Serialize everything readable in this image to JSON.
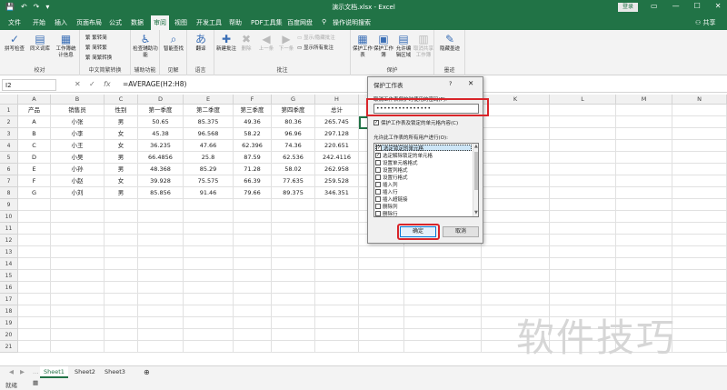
{
  "titlebar": {
    "qat": [
      "💾",
      "↶",
      "↷",
      "▾"
    ],
    "doc_title": "演示文档.xlsx - Excel",
    "login": "登录",
    "win_buttons": [
      "▭",
      "—",
      "☐",
      "✕"
    ]
  },
  "tabs": [
    "文件",
    "开始",
    "插入",
    "页面布局",
    "公式",
    "数据",
    "审阅",
    "视图",
    "开发工具",
    "帮助",
    "PDF工具集",
    "百度网盘",
    "操作说明搜索"
  ],
  "active_tab": "审阅",
  "share": "共享",
  "ribbon": {
    "proofing": {
      "label": "校对",
      "spell": "拼写检查",
      "thesaurus": "同义词库",
      "stats": "工作簿统计信息"
    },
    "chinese": {
      "label": "中文简繁转换",
      "t2s": "繁转简",
      "s2t": "简转繁",
      "convert": "简繁转换"
    },
    "accessibility": {
      "label": "辅助功能",
      "check": "检查辅助功能"
    },
    "insights": {
      "label": "见解",
      "smart": "智能查找"
    },
    "language": {
      "label": "语言",
      "translate": "翻译"
    },
    "comments": {
      "label": "批注",
      "new": "新建批注",
      "delete": "删除",
      "prev": "上一条",
      "next": "下一条",
      "show_hide": "显示/隐藏批注",
      "show_all": "显示所有批注"
    },
    "protect": {
      "label": "保护",
      "sheet": "保护工作表",
      "workbook": "保护工作簿",
      "allow": "允许编辑区域",
      "unshare": "取消共享工作簿"
    },
    "ink": {
      "label": "墨迹",
      "hide": "隐藏墨迹"
    }
  },
  "formula_bar": {
    "name_box": "I2",
    "cancel": "✕",
    "enter": "✓",
    "fx": "fx",
    "formula": "=AVERAGE(H2:H8)"
  },
  "columns": [
    "A",
    "B",
    "C",
    "D",
    "E",
    "F",
    "G",
    "H",
    "I",
    "J",
    "K",
    "L",
    "M",
    "N"
  ],
  "rows": [
    "1",
    "2",
    "3",
    "4",
    "5",
    "6",
    "7",
    "8",
    "9",
    "10",
    "11",
    "12",
    "13",
    "14",
    "15",
    "16",
    "17",
    "18",
    "19",
    "20",
    "21"
  ],
  "table": {
    "headers": [
      "产品",
      "销售员",
      "性别",
      "第一季度",
      "第二季度",
      "第三季度",
      "第四季度",
      "总计"
    ],
    "rows": [
      [
        "A",
        "小张",
        "男",
        "50.65",
        "85.375",
        "49.36",
        "80.36",
        "265.745"
      ],
      [
        "B",
        "小李",
        "女",
        "45.38",
        "96.568",
        "58.22",
        "96.96",
        "297.128"
      ],
      [
        "C",
        "小王",
        "女",
        "36.235",
        "47.66",
        "62.396",
        "74.36",
        "220.651"
      ],
      [
        "D",
        "小吴",
        "男",
        "66.4856",
        "25.8",
        "87.59",
        "62.536",
        "242.4116"
      ],
      [
        "E",
        "小孙",
        "男",
        "48.368",
        "85.29",
        "71.28",
        "58.02",
        "262.958"
      ],
      [
        "F",
        "小赵",
        "女",
        "39.928",
        "75.575",
        "66.39",
        "77.635",
        "259.528"
      ],
      [
        "G",
        "小刘",
        "男",
        "85.856",
        "91.46",
        "79.66",
        "89.375",
        "346.351"
      ]
    ]
  },
  "sheets": [
    "Sheet1",
    "Sheet2",
    "Sheet3"
  ],
  "add_sheet": "⊕",
  "status": "就绪",
  "dialog": {
    "title": "保护工作表",
    "help": "?",
    "close": "✕",
    "password_label": "取消工作表保护时使用的密码(P):",
    "password_value": "•••••••••••••••",
    "protect_check": "保护工作表及锁定的单元格内容(C)",
    "allow_label": "允许此工作表的所有用户进行(O):",
    "options": [
      {
        "label": "选定锁定的单元格",
        "checked": true
      },
      {
        "label": "选定解除锁定的单元格",
        "checked": true
      },
      {
        "label": "设置单元格格式",
        "checked": false
      },
      {
        "label": "设置列格式",
        "checked": false
      },
      {
        "label": "设置行格式",
        "checked": false
      },
      {
        "label": "插入列",
        "checked": false
      },
      {
        "label": "插入行",
        "checked": false
      },
      {
        "label": "插入超链接",
        "checked": false
      },
      {
        "label": "删除列",
        "checked": false
      },
      {
        "label": "删除行",
        "checked": false
      }
    ],
    "ok": "确定",
    "cancel": "取消"
  },
  "watermark": "软件技巧"
}
